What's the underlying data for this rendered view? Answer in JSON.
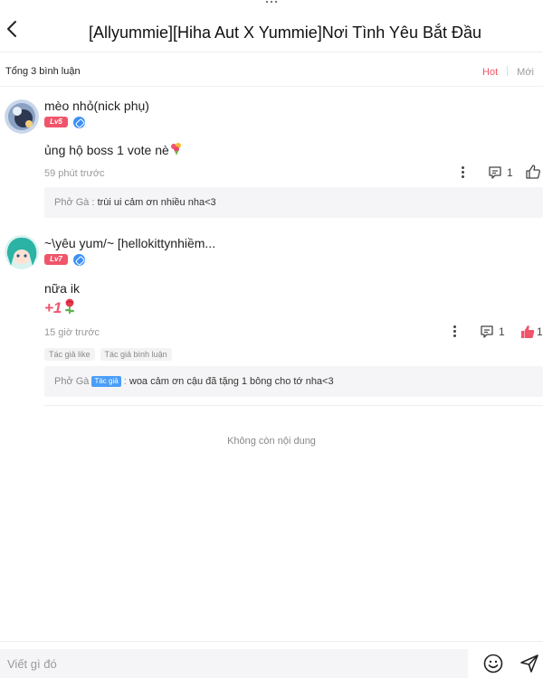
{
  "header": {
    "title": "[Allyummie][Hiha Aut X Yummie]Nơi Tình Yêu Bắt Đầu"
  },
  "subbar": {
    "count_label": "Tổng 3 bình luận",
    "sort_hot": "Hot",
    "sort_new": "Mới"
  },
  "comments": [
    {
      "username": "mèo nhỏ(nick phụ)",
      "level": "Lv5",
      "text": "ủng hộ boss 1 vote nè",
      "time": "59 phút trước",
      "reply_count": "1",
      "reply": {
        "name": "Phở Gà",
        "separator": " : ",
        "text": "trùi ui cảm ơn nhiều nha<3"
      }
    },
    {
      "username": "~\\yêu yum/~ [hellokittynhiềm...",
      "level": "Lv7",
      "text": "nữa ik",
      "gift": "+1",
      "time": "15 giờ trước",
      "reply_count": "1",
      "like_count": "1",
      "tags": [
        "Tác giả like",
        "Tác giả bình luận"
      ],
      "reply": {
        "name": "Phở Gà",
        "author_tag": "Tác giả",
        "separator": " : ",
        "text": "woa cảm ơn cậu đã tặng 1 bông cho tớ nha<3"
      }
    }
  ],
  "footer": {
    "no_more": "Không còn nội dung"
  },
  "composer": {
    "placeholder": "Viết gì đó"
  },
  "colors": {
    "accent": "#f0556b",
    "verified": "#3b8ff7",
    "author_tag": "#4a9ef8"
  },
  "icons": [
    "back-icon",
    "verified-icon",
    "bouquet-icon",
    "rose-icon",
    "more-icon",
    "comment-icon",
    "thumbs-up-icon",
    "emoji-icon",
    "send-icon"
  ]
}
